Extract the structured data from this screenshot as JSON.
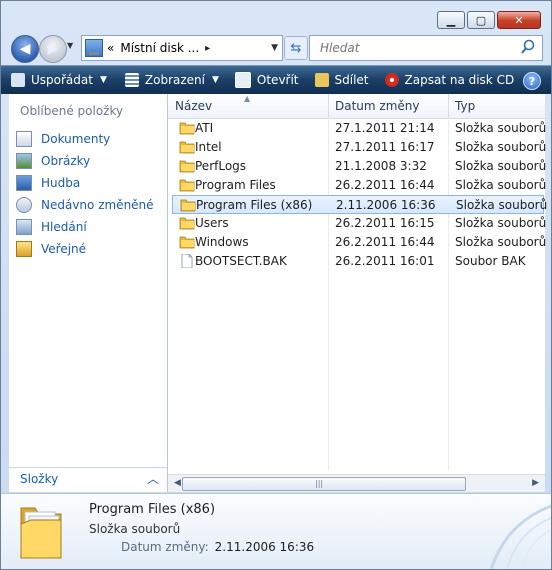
{
  "window": {
    "buttons": [
      "minimize",
      "maximize",
      "close"
    ],
    "colors": {
      "close": "#c43f26",
      "toolbar": "#1b3f66",
      "link": "#1a5ab0",
      "selection": "#d6e8ff"
    }
  },
  "address": {
    "prefix": "«",
    "path": "Místní disk ...",
    "separator": "▸"
  },
  "search": {
    "placeholder": "Hledat"
  },
  "toolbar": {
    "organize": "Uspořádat",
    "views": "Zobrazení",
    "open": "Otevřít",
    "share": "Sdílet",
    "burn": "Zapsat na disk CD"
  },
  "navpane": {
    "header": "Oblíbené položky",
    "items": [
      {
        "label": "Dokumenty",
        "icon": "documents-icon"
      },
      {
        "label": "Obrázky",
        "icon": "pictures-icon"
      },
      {
        "label": "Hudba",
        "icon": "music-icon"
      },
      {
        "label": "Nedávno změněné",
        "icon": "recent-icon"
      },
      {
        "label": "Hledání",
        "icon": "search-icon"
      },
      {
        "label": "Veřejné",
        "icon": "public-icon"
      }
    ],
    "folders_label": "Složky"
  },
  "columns": {
    "name": "Název",
    "date": "Datum změny",
    "type": "Typ"
  },
  "files": [
    {
      "name": "ATI",
      "date": "27.1.2011 21:14",
      "type": "Složka souborů",
      "kind": "folder"
    },
    {
      "name": "Intel",
      "date": "27.1.2011 16:17",
      "type": "Složka souborů",
      "kind": "folder"
    },
    {
      "name": "PerfLogs",
      "date": "21.1.2008 3:32",
      "type": "Složka souborů",
      "kind": "folder"
    },
    {
      "name": "Program Files",
      "date": "26.2.2011 16:44",
      "type": "Složka souborů",
      "kind": "folder"
    },
    {
      "name": "Program Files (x86)",
      "date": "2.11.2006 16:36",
      "type": "Složka souborů",
      "kind": "folder",
      "selected": true
    },
    {
      "name": "Users",
      "date": "26.2.2011 16:15",
      "type": "Složka souborů",
      "kind": "folder"
    },
    {
      "name": "Windows",
      "date": "26.2.2011 16:44",
      "type": "Složka souborů",
      "kind": "folder"
    },
    {
      "name": "BOOTSECT.BAK",
      "date": "26.2.2011 16:01",
      "type": "Soubor BAK",
      "kind": "file"
    }
  ],
  "details": {
    "title": "Program Files (x86)",
    "type": "Složka souborů",
    "date_label": "Datum změny:",
    "date_value": "2.11.2006 16:36"
  }
}
